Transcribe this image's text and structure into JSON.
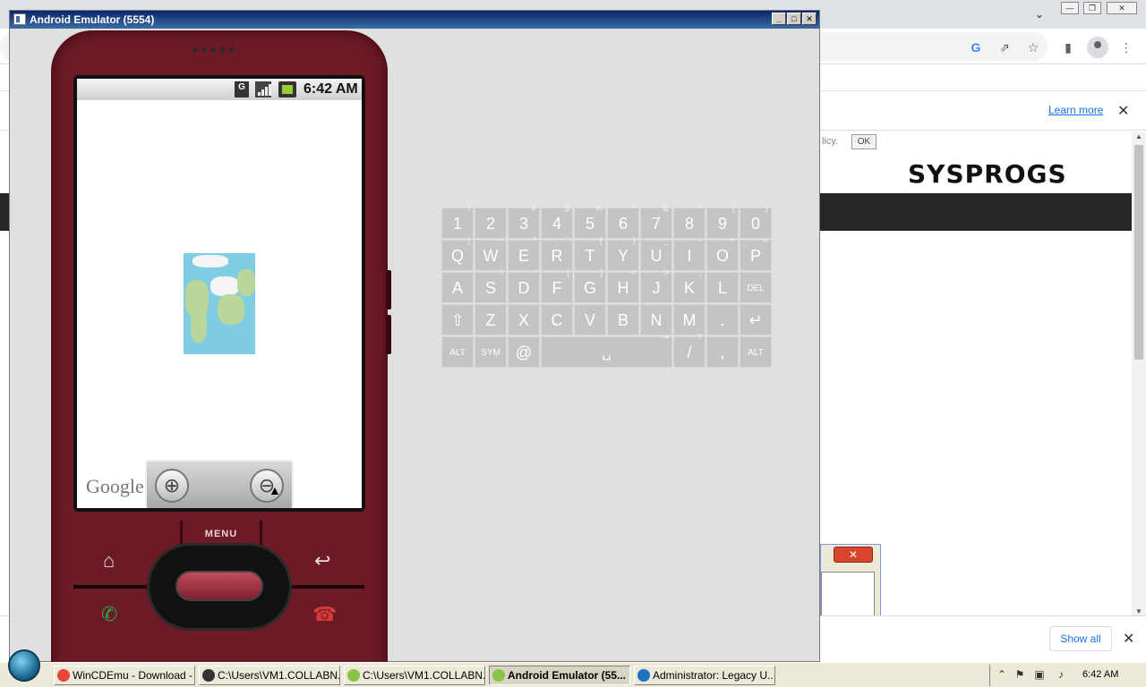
{
  "browser": {
    "learn_more": "Learn more",
    "cookie_text": "licy.",
    "cookie_ok": "OK",
    "site_logo": "SYSPROGS",
    "show_all": "Show all"
  },
  "emulator": {
    "title": "Android Emulator (5554)",
    "status_network": "G",
    "time": "6:42 AM",
    "map_brand": "Google",
    "menu_label": "MENU",
    "zoom_in": "⊕",
    "zoom_out": "⊖"
  },
  "keyboard": {
    "rows": [
      [
        {
          "k": "1",
          "a": "!"
        },
        {
          "k": "2",
          "a": "\""
        },
        {
          "k": "3",
          "a": "#"
        },
        {
          "k": "4",
          "a": "$"
        },
        {
          "k": "5",
          "a": "%"
        },
        {
          "k": "6",
          "a": "^"
        },
        {
          "k": "7",
          "a": "&"
        },
        {
          "k": "8",
          "a": "*"
        },
        {
          "k": "9",
          "a": "("
        },
        {
          "k": "0",
          "a": ")"
        }
      ],
      [
        {
          "k": "Q",
          "a": "|"
        },
        {
          "k": "W",
          "a": "~"
        },
        {
          "k": "E",
          "a": "\""
        },
        {
          "k": "R",
          "a": "`"
        },
        {
          "k": "T",
          "a": "{"
        },
        {
          "k": "Y",
          "a": "}"
        },
        {
          "k": "U",
          "a": "_"
        },
        {
          "k": "I",
          "a": "-"
        },
        {
          "k": "O",
          "a": "+"
        },
        {
          "k": "P",
          "a": "="
        }
      ],
      [
        {
          "k": "A",
          "a": ""
        },
        {
          "k": "S",
          "a": "\\"
        },
        {
          "k": "D",
          "a": "'"
        },
        {
          "k": "F",
          "a": "["
        },
        {
          "k": "G",
          "a": "]"
        },
        {
          "k": "H",
          "a": "<"
        },
        {
          "k": "J",
          "a": ">"
        },
        {
          "k": "K",
          "a": ";"
        },
        {
          "k": "L",
          "a": ":"
        },
        {
          "k": "DEL",
          "a": ""
        }
      ],
      [
        {
          "k": "⇧",
          "a": ""
        },
        {
          "k": "Z",
          "a": ""
        },
        {
          "k": "X",
          "a": ""
        },
        {
          "k": "C",
          "a": ""
        },
        {
          "k": "V",
          "a": ""
        },
        {
          "k": "B",
          "a": ""
        },
        {
          "k": "N",
          "a": ""
        },
        {
          "k": "M",
          "a": ""
        },
        {
          "k": ".",
          "a": ""
        },
        {
          "k": "↵",
          "a": ""
        }
      ],
      [
        {
          "k": "ALT",
          "a": ""
        },
        {
          "k": "SYM",
          "a": ""
        },
        {
          "k": "@",
          "a": ""
        },
        {
          "k": "␣",
          "a": "⇥"
        },
        {
          "k": "/",
          "a": "?"
        },
        {
          "k": ",",
          "a": ""
        },
        {
          "k": "ALT",
          "a": ""
        }
      ]
    ]
  },
  "taskbar": {
    "items": [
      {
        "label": "WinCDEmu - Download - ...",
        "active": false,
        "color": "#e8453c"
      },
      {
        "label": "C:\\Users\\VM1.COLLABN...",
        "active": false,
        "color": "#333333"
      },
      {
        "label": "C:\\Users\\VM1.COLLABN...",
        "active": false,
        "color": "#8bc34a"
      },
      {
        "label": "Android Emulator (55...",
        "active": true,
        "color": "#8bc34a"
      },
      {
        "label": "Administrator: Legacy U...",
        "active": false,
        "color": "#1e73be"
      }
    ],
    "time": "6:42 AM"
  }
}
